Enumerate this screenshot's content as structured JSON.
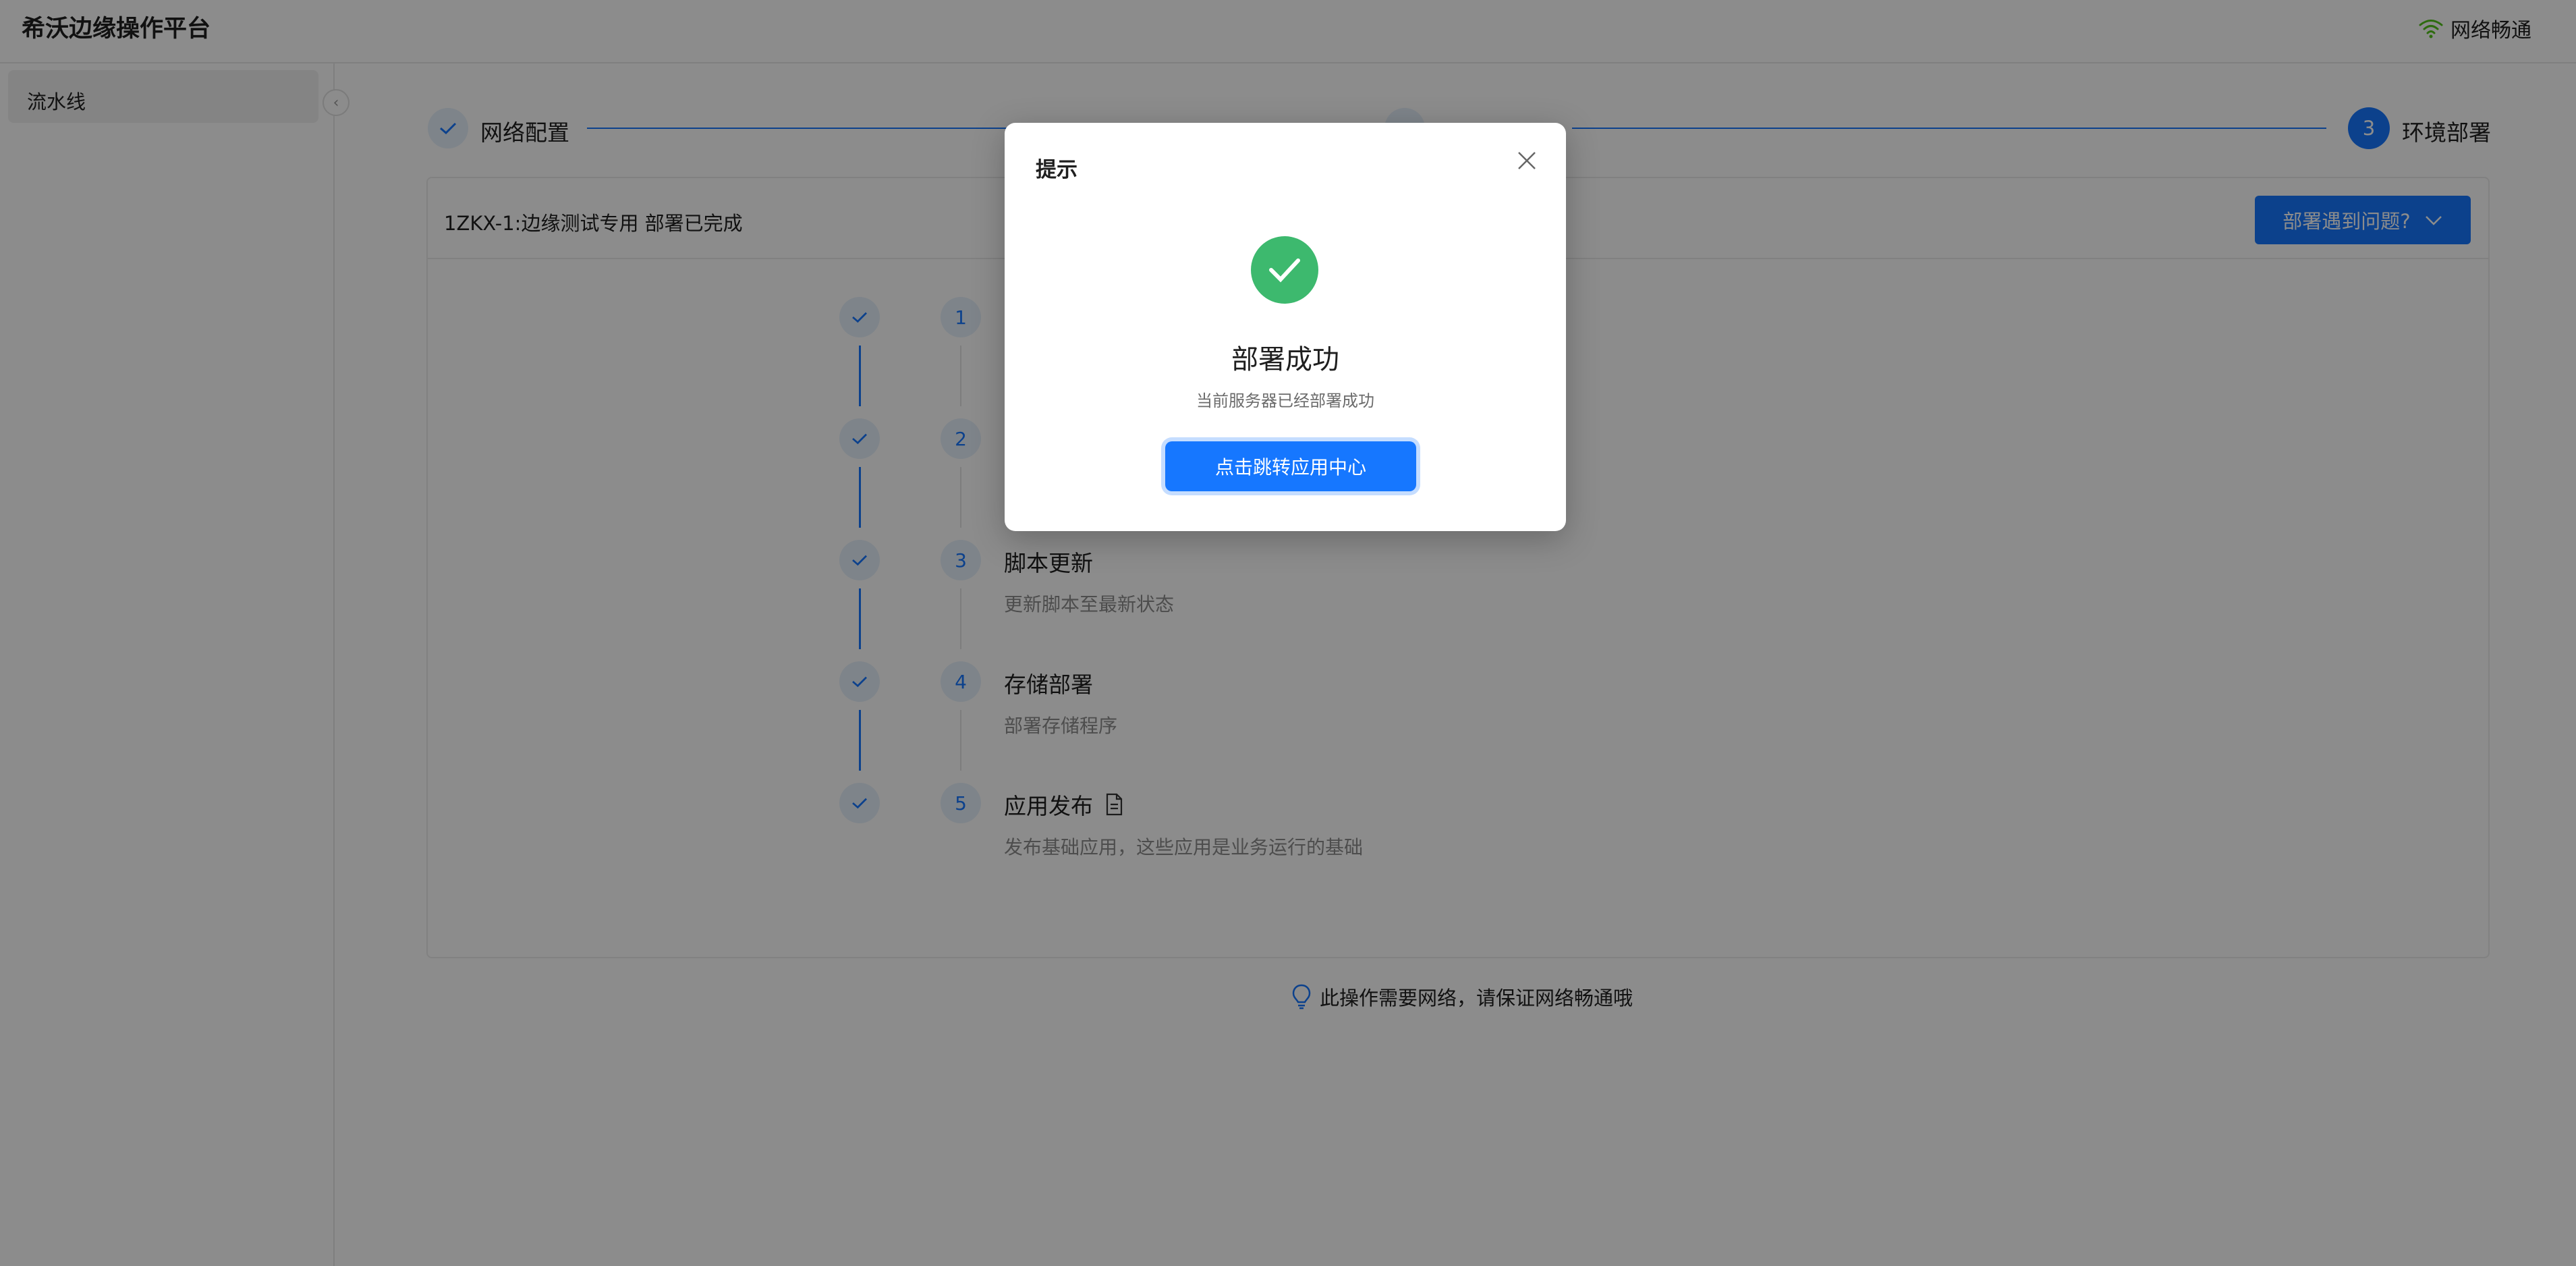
{
  "header": {
    "app_title": "希沃边缘操作平台",
    "network_status": "网络畅通"
  },
  "sidebar": {
    "items": [
      {
        "label": "流水线"
      }
    ],
    "collapse_icon": "chevron-left-icon"
  },
  "top_steps": [
    {
      "label": "网络配置",
      "status": "done"
    },
    {
      "label": "",
      "status": "done"
    },
    {
      "number": "3",
      "label": "环境部署",
      "status": "active"
    }
  ],
  "card": {
    "title": "1ZKX-1:边缘测试专用 部署已完成",
    "issue_button": "部署遇到问题?"
  },
  "timeline": [
    {
      "number": "1",
      "title": "",
      "desc": ""
    },
    {
      "number": "2",
      "title": "",
      "desc": ""
    },
    {
      "number": "3",
      "title": "脚本更新",
      "desc": "更新脚本至最新状态"
    },
    {
      "number": "4",
      "title": "存储部署",
      "desc": "部署存储程序"
    },
    {
      "number": "5",
      "title": "应用发布",
      "desc": "发布基础应用，这些应用是业务运行的基础",
      "icon": "document-icon"
    }
  ],
  "tip": {
    "text": "此操作需要网络，请保证网络畅通哦",
    "icon": "lightbulb-icon"
  },
  "modal": {
    "title": "提示",
    "heading": "部署成功",
    "subtext": "当前服务器已经部署成功",
    "button": "点击跳转应用中心"
  },
  "colors": {
    "primary": "#1677ff",
    "success": "#3db96e",
    "mask": "rgba(0,0,0,0.45)"
  }
}
